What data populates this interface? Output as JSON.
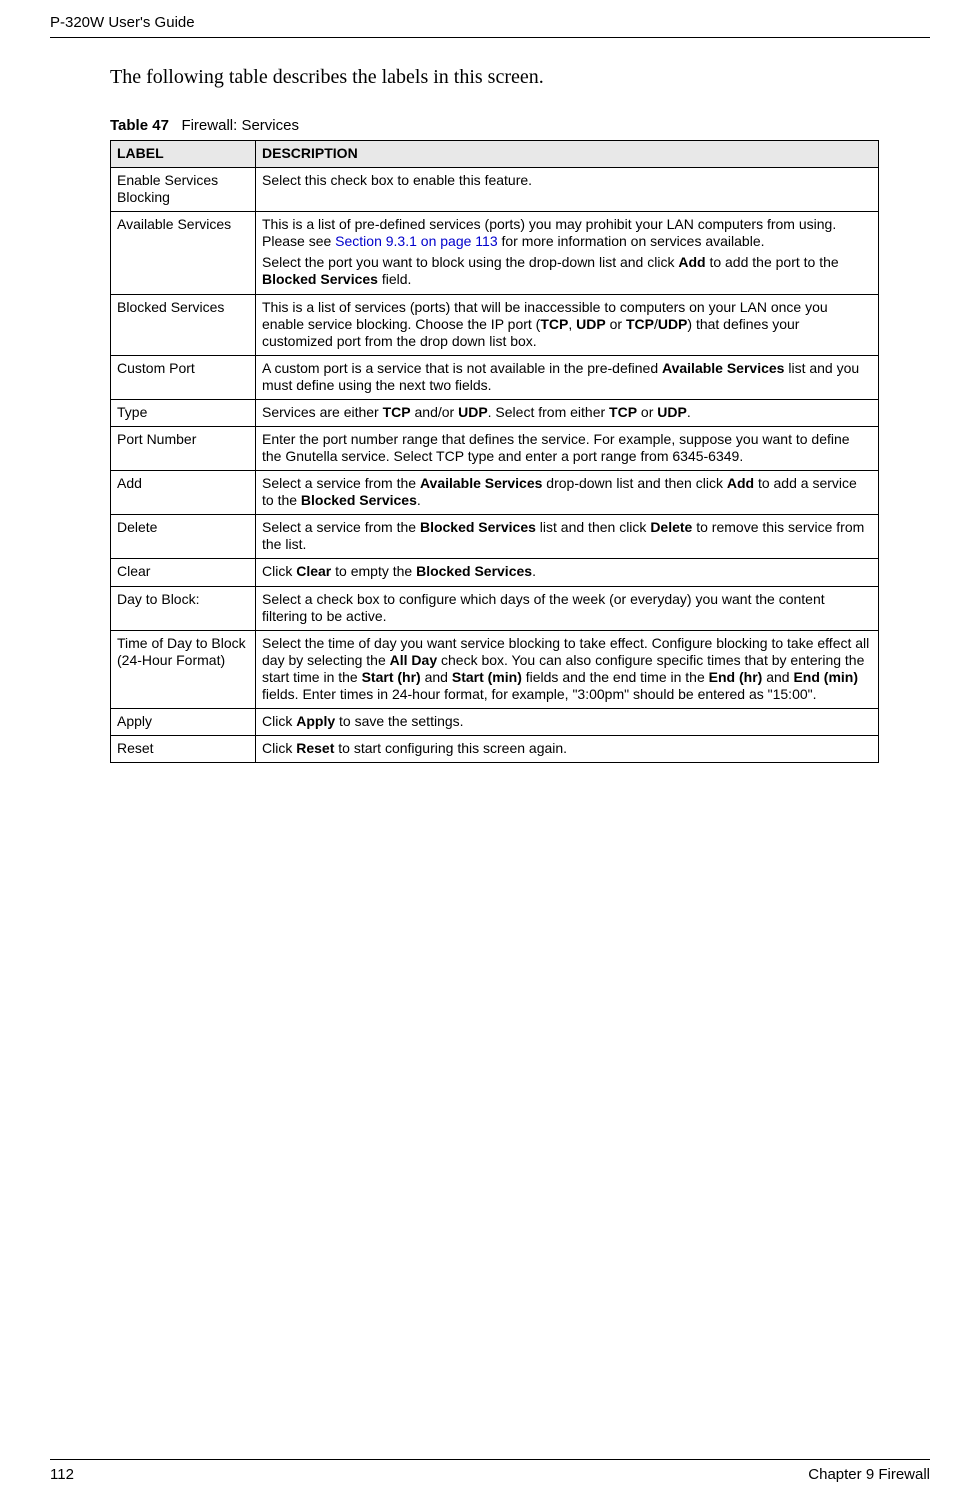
{
  "header": {
    "running_head": "P-320W User's Guide"
  },
  "intro": "The following table describes the labels in this screen.",
  "table_caption": {
    "prefix": "Table 47",
    "title": "Firewall: Services"
  },
  "columns": {
    "label": "LABEL",
    "description": "DESCRIPTION"
  },
  "rows": {
    "r0": {
      "label": "Enable Services Blocking",
      "desc": "Select this check box to enable this feature."
    },
    "r1": {
      "label": "Available Services",
      "desc_part1": "This is a list of pre-defined services (ports) you may prohibit your LAN computers from using. Please see ",
      "desc_link": "Section 9.3.1 on page 113",
      "desc_part2": " for more information on services available.",
      "desc_line2a": "Select the port you want to block using the drop-down list and click ",
      "desc_add": "Add",
      "desc_line2b": " to add the port to the ",
      "desc_bs": "Blocked Services",
      "desc_line2c": " field."
    },
    "r2": {
      "label": "Blocked Services",
      "a": "This is a list of services (ports) that will be inaccessible to computers on your LAN once you enable service blocking. Choose the IP port (",
      "b_tcp": "TCP",
      "c": ", ",
      "b_udp": "UDP",
      "d": " or ",
      "b_tcp2": "TCP",
      "slash": "/",
      "b_udp2": "UDP",
      "e": ") that defines your customized port from the drop down list box."
    },
    "r3": {
      "label": "Custom Port",
      "a": "A custom port is a service that is not available in the pre-defined ",
      "b_avail": "Available Services",
      "c": " list and you must define using the next two fields."
    },
    "r4": {
      "label": "Type",
      "a": "Services are either ",
      "b_tcp": "TCP",
      "c": " and/or ",
      "b_udp": "UDP",
      "d": ". Select from either ",
      "b_tcp2": "TCP",
      "e": " or ",
      "b_udp2": "UDP",
      "f": "."
    },
    "r5": {
      "label": "Port Number",
      "desc": "Enter the port number range that defines the service. For example, suppose you want to define the Gnutella service. Select TCP type and enter a port range from 6345-6349."
    },
    "r6": {
      "label": "Add",
      "a": "Select a service from the ",
      "b_avail": "Available Services",
      "c": " drop-down list and then click ",
      "b_add": "Add",
      "d": " to add a service to the ",
      "b_bs": "Blocked Services",
      "e": "."
    },
    "r7": {
      "label": "Delete",
      "a": "Select a service from the ",
      "b_bs": "Blocked Services",
      "c": " list and then click ",
      "b_del": "Delete",
      "d": " to remove this service from the list."
    },
    "r8": {
      "label": "Clear",
      "a": "Click ",
      "b_clear": "Clear",
      "c": " to empty the ",
      "b_bs": "Blocked Services",
      "d": "."
    },
    "r9": {
      "label": "Day to Block:",
      "desc": "Select a check box to configure which days of the week (or everyday) you want the content filtering to be active."
    },
    "r10": {
      "label": "Time of Day to Block (24-Hour Format)",
      "a": "Select the time of day you want service blocking to take effect. Configure blocking to take effect all day by selecting the ",
      "b_all": "All Day",
      "c": " check box. You can also configure specific times that by entering the start time in the ",
      "b_sh": "Start (hr)",
      "d": " and ",
      "b_sm": "Start (min)",
      "e": " fields and the end time in the ",
      "b_eh": "End (hr)",
      "f": " and ",
      "b_em": "End (min)",
      "g": " fields. Enter times in 24-hour format, for example, \"3:00pm\" should be entered as \"15:00\"."
    },
    "r11": {
      "label": "Apply",
      "a": "Click ",
      "b": "Apply",
      "c": " to save the settings."
    },
    "r12": {
      "label": "Reset",
      "a": "Click ",
      "b": "Reset",
      "c": " to start configuring this screen again."
    }
  },
  "footer": {
    "page_number": "112",
    "chapter": "Chapter 9 Firewall"
  }
}
